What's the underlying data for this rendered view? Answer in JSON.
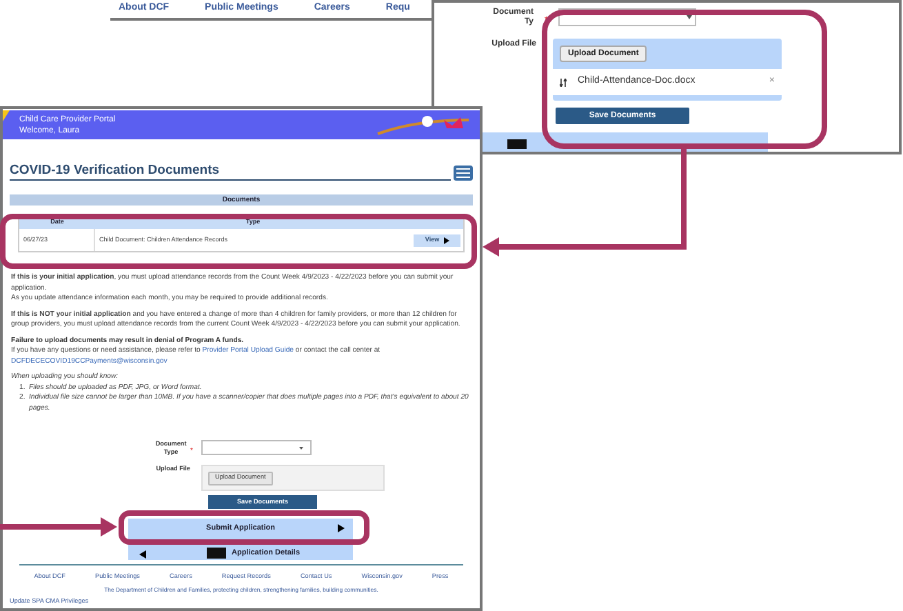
{
  "top_strip": {
    "footer_links": [
      "About DCF",
      "Public Meetings",
      "Careers",
      "Requ"
    ]
  },
  "zoom_panel": {
    "document_type_label": [
      "Document",
      "Ty"
    ],
    "required_mark": "*",
    "upload_label": "Upload File",
    "upload_button": "Upload Document",
    "file": {
      "name": "Child-Attendance-Doc.docx",
      "remove": "×"
    },
    "save_button": "Save Documents"
  },
  "portal": {
    "header": {
      "title": "Child Care Provider Portal",
      "welcome": "Welcome, Laura"
    },
    "page_title": "COVID-19 Verification Documents",
    "documents": {
      "title": "Documents",
      "columns": [
        "Date",
        "Type"
      ],
      "rows": [
        {
          "date": "06/27/23",
          "type": "Child Document: Children Attendance Records",
          "action": "View"
        }
      ]
    },
    "notices": [
      [
        "**If this is your initial application**, you must upload attendance records from the Count Week 4/9/2023 - 4/22/2023 before you can submit your application.",
        "As you update attendance information each month, you may be required to provide additional records."
      ],
      [
        "**If this is NOT your initial application** and you have entered a change of more than 4 children for family providers, or more than 12 children for group providers, you must upload attendance records from the current Count Week 4/9/2023 - 4/22/2023 before you can submit your application."
      ]
    ],
    "warning": "Failure to upload documents may result in denial of Program A funds.",
    "help": {
      "intro": "If you have any questions or need assistance, please refer to",
      "link": "Provider Portal Upload Guide",
      "after": "or contact the call center at",
      "email": "DCFDECECOVID19CCPayments@wisconsin.gov"
    },
    "tips_title": "When uploading you should know:",
    "tips": [
      {
        "number": "1.",
        "text": "Files should be uploaded as PDF, JPG, or Word format."
      },
      {
        "number": "2.",
        "text": "Individual file size cannot be larger than 10MB. If you have a scanner/copier that does multiple pages into a PDF, that's equivalent to about 20 pages."
      }
    ],
    "form": {
      "document_type_label": "Document Type",
      "required_mark": "*",
      "upload_label": "Upload File",
      "upload_button": "Upload Document",
      "save_button": "Save Documents"
    },
    "submit_button": "Submit Application",
    "details_button": "Application Details",
    "footer_links": [
      "About DCF",
      "Public Meetings",
      "Careers",
      "Request Records",
      "Contact Us",
      "Wisconsin.gov",
      "Press"
    ],
    "tagline": "The Department of Children and Families, protecting children, strengthening families, building communities.",
    "privileges_link": "Update SPA CMA Privileges"
  }
}
